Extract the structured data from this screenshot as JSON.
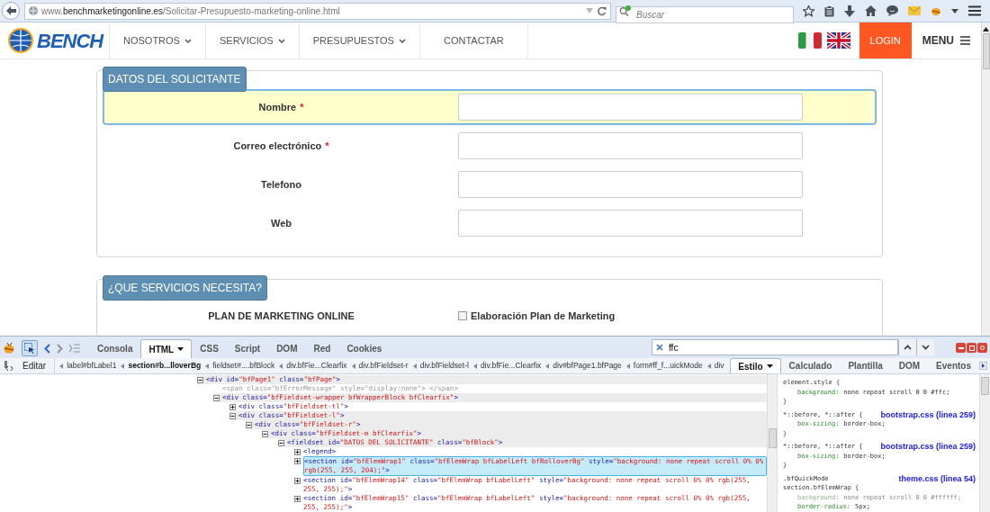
{
  "browser": {
    "url": "www.**benchmarketingonline.es**/Solicitar-Presupuesto-marketing-online.html",
    "search": {
      "placeholder": "Buscar"
    }
  },
  "site": {
    "logo": "BENCH",
    "nav": [
      {
        "label": "NOSOTROS",
        "dropdown": true
      },
      {
        "label": "SERVICIOS",
        "dropdown": true
      },
      {
        "label": "PRESUPUESTOS",
        "dropdown": true
      },
      {
        "label": "CONTACTAR",
        "dropdown": false
      }
    ],
    "login": "LOGIN",
    "menu": "MENU",
    "sections": [
      {
        "legend": "DATOS DEL SOLICITANTE",
        "fields": [
          {
            "kind": "text",
            "label": "Nombre",
            "required_mark": "*",
            "highlighted": true
          },
          {
            "kind": "text",
            "label": "Correo electrónico",
            "required_mark": "*",
            "highlighted": false
          },
          {
            "kind": "text",
            "label": "Telefono",
            "highlighted": false
          },
          {
            "kind": "text",
            "label": "Web",
            "highlighted": false
          }
        ]
      },
      {
        "legend": "¿QUE SERVICIOS NECESITA?",
        "fields": [
          {
            "kind": "checkbox",
            "label": "PLAN DE MARKETING ONLINE",
            "option": "Elaboración Plan de Marketing",
            "checked": false,
            "highlighted": false
          }
        ]
      }
    ]
  },
  "devtools": {
    "tabs": [
      {
        "label": "Consola",
        "selected": false,
        "menu": false
      },
      {
        "label": "HTML",
        "selected": true,
        "menu": true
      },
      {
        "label": "CSS",
        "selected": false,
        "menu": false
      },
      {
        "label": "Script",
        "selected": false,
        "menu": false
      },
      {
        "label": "DOM",
        "selected": false,
        "menu": false
      },
      {
        "label": "Red",
        "selected": false,
        "menu": false
      },
      {
        "label": "Cookies",
        "selected": false,
        "menu": false
      }
    ],
    "search": {
      "value": "ffc"
    },
    "edit": "Editar",
    "breadcrumbs": [
      {
        "label": "label#bfLabel1",
        "selected": false
      },
      {
        "label": "section#b...lloverBg",
        "selected": true
      },
      {
        "label": "fieldset#....bfBlock",
        "selected": false
      },
      {
        "label": "div.bfFie...Clearfix",
        "selected": false
      },
      {
        "label": "div.bfFieldset-r",
        "selected": false
      },
      {
        "label": "div.bfFieldset-l",
        "selected": false
      },
      {
        "label": "div.bfFie...Clearfix",
        "selected": false
      },
      {
        "label": "div#bfPage1.bfPage",
        "selected": false
      },
      {
        "label": "form#ff_f...uickMode",
        "selected": false
      },
      {
        "label": "div",
        "selected": false
      }
    ],
    "side_tabs": [
      {
        "label": "Estilo",
        "selected": true,
        "menu": true
      },
      {
        "label": "Calculado",
        "selected": false,
        "menu": false
      },
      {
        "label": "Plantilla",
        "selected": false,
        "menu": false
      },
      {
        "label": "DOM",
        "selected": false,
        "menu": false
      },
      {
        "label": "Eventos",
        "selected": false,
        "menu": false
      }
    ],
    "tree": [
      {
        "text": "<div id=\"bfPage1\" class=\"bfPage\">",
        "expanded": true,
        "selected": false,
        "children": [
          {
            "text": "<span class=\"bfErrorMessage\" style=\"display:none\"> </span>",
            "kind": "leaf",
            "muted": true,
            "selected": false
          },
          {
            "text": "<div class=\"bfFieldset-wrapper bfWrapperBlock bfClearfix\">",
            "expanded": true,
            "selected": false,
            "children": [
              {
                "text": "<div class=\"bfFieldset-tl\">",
                "expanded": false,
                "selected": false
              },
              {
                "text": "<div class=\"bfFieldset-l\">",
                "expanded": true,
                "selected": false,
                "children": [
                  {
                    "text": "<div class=\"bfFieldset-r\">",
                    "expanded": true,
                    "selected": false,
                    "children": [
                      {
                        "text": "<div class=\"bfFieldset-m bfClearfix\">",
                        "expanded": true,
                        "selected": false,
                        "children": [
                          {
                            "text": "<fieldset id=\"DATOS DEL SOLICITANTE\" class=\"bfBlock\">",
                            "expanded": true,
                            "selected": false,
                            "children": [
                              {
                                "text": "<legend>",
                                "expanded": false,
                                "selected": false
                              },
                              {
                                "text": "<section id=\"bfElemWrap1\" class=\"bfElemWrap bfLabelLeft bfRolloverBg\" style=\"background: none repeat scroll 0% 0% rgb(255, 255, 204);\">",
                                "expanded": false,
                                "selected": true
                              },
                              {
                                "text": "<section id=\"bfElemWrap14\" class=\"bfElemWrap bfLabelLeft\" style=\"background: none repeat scroll 0% 0% rgb(255, 255, 255);\">",
                                "expanded": false,
                                "selected": false
                              },
                              {
                                "text": "<section id=\"bfElemWrap15\" class=\"bfElemWrap bfLabelLeft\" style=\"background: none repeat scroll 0% 0% rgb(255, 255, 255);\">",
                                "expanded": false,
                                "selected": false
                              }
                            ]
                          }
                        ]
                      }
                    ]
                  }
                ]
              }
            ]
          }
        ]
      }
    ],
    "style_rules": [
      {
        "selector": [
          "element.style {"
        ],
        "declarations": [
          {
            "property": "background:",
            "value": "none repeat scroll 0 0 #ffc;",
            "overridden": false
          }
        ],
        "close": "}"
      },
      {
        "selector": [
          "*::before, *::after {"
        ],
        "source": "bootstrap.css (linea 259)",
        "declarations": [
          {
            "property": "box-sizing:",
            "value": "border-box;",
            "overridden": false
          }
        ],
        "close": "}"
      },
      {
        "selector": [
          "*::before, *::after {"
        ],
        "source": "bootstrap.css (linea 259)",
        "declarations": [
          {
            "property": "box-sizing:",
            "value": "border-box;",
            "overridden": false
          }
        ],
        "close": "}"
      },
      {
        "selector": [
          ".bfQuickMode",
          "section.bfElemWrap {"
        ],
        "source": "theme.css (linea 54)",
        "declarations": [
          {
            "property": "background:",
            "value": "none repeat scroll 0 0 #ffffff;",
            "overridden": true
          },
          {
            "property": "border-radius:",
            "value": "5px;",
            "overridden": false
          }
        ]
      }
    ]
  }
}
